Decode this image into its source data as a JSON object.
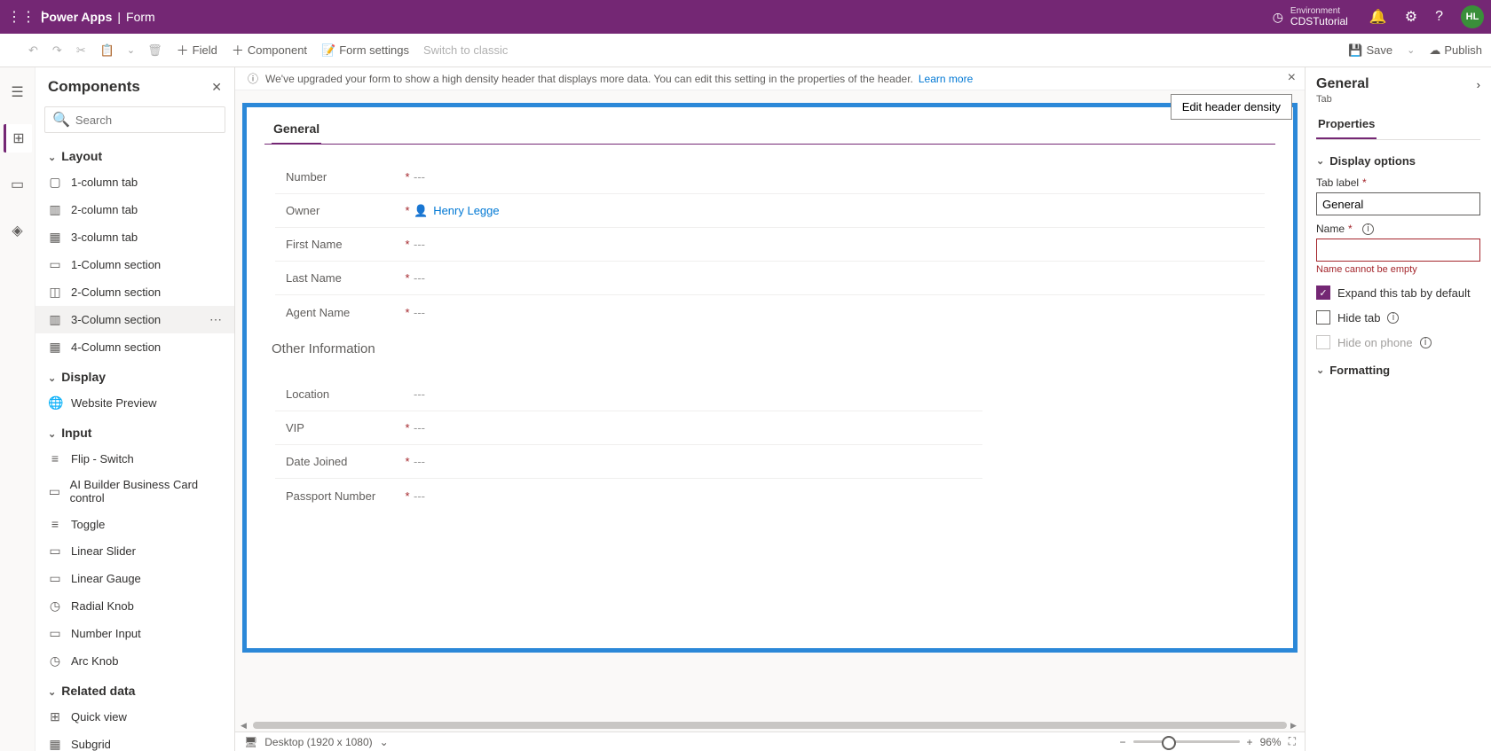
{
  "topbar": {
    "app": "Power Apps",
    "page": "Form",
    "env_label": "Environment",
    "env_name": "CDSTutorial",
    "user_initials": "HL"
  },
  "cmdbar": {
    "field": "Field",
    "component": "Component",
    "form_settings": "Form settings",
    "switch_classic": "Switch to classic",
    "save": "Save",
    "publish": "Publish"
  },
  "info_bar": {
    "text": "We've upgraded your form to show a high density header that displays more data. You can edit this setting in the properties of the header.",
    "link": "Learn more",
    "density_btn": "Edit header density"
  },
  "components": {
    "title": "Components",
    "search_ph": "Search",
    "groups": {
      "layout": {
        "label": "Layout",
        "items": [
          "1-column tab",
          "2-column tab",
          "3-column tab",
          "1-Column section",
          "2-Column section",
          "3-Column section",
          "4-Column section"
        ]
      },
      "display": {
        "label": "Display",
        "items": [
          "Website Preview"
        ]
      },
      "input": {
        "label": "Input",
        "items": [
          "Flip - Switch",
          "AI Builder Business Card control",
          "Toggle",
          "Linear Slider",
          "Linear Gauge",
          "Radial Knob",
          "Number Input",
          "Arc Knob"
        ]
      },
      "related": {
        "label": "Related data",
        "items": [
          "Quick view",
          "Subgrid"
        ]
      }
    }
  },
  "form": {
    "tab": "General",
    "section1": {
      "fields": [
        {
          "label": "Number",
          "req": true,
          "value": "---",
          "person": false
        },
        {
          "label": "Owner",
          "req": true,
          "value": "Henry Legge",
          "person": true
        },
        {
          "label": "First Name",
          "req": true,
          "value": "---",
          "person": false
        },
        {
          "label": "Last Name",
          "req": true,
          "value": "---",
          "person": false
        },
        {
          "label": "Agent Name",
          "req": true,
          "value": "---",
          "person": false
        }
      ]
    },
    "section2": {
      "title": "Other Information",
      "fields": [
        {
          "label": "Location",
          "req": false,
          "value": "---"
        },
        {
          "label": "VIP",
          "req": true,
          "value": "---"
        },
        {
          "label": "Date Joined",
          "req": true,
          "value": "---"
        },
        {
          "label": "Passport Number",
          "req": true,
          "value": "---"
        }
      ]
    }
  },
  "status": {
    "device": "Desktop (1920 x 1080)",
    "zoom": "96%"
  },
  "props": {
    "title": "General",
    "sub": "Tab",
    "tab": "Properties",
    "display_options": "Display options",
    "tab_label": "Tab label",
    "tab_label_val": "General",
    "name": "Name",
    "name_val": "",
    "name_err": "Name cannot be empty",
    "expand": "Expand this tab by default",
    "hide_tab": "Hide tab",
    "hide_phone": "Hide on phone",
    "formatting": "Formatting"
  }
}
